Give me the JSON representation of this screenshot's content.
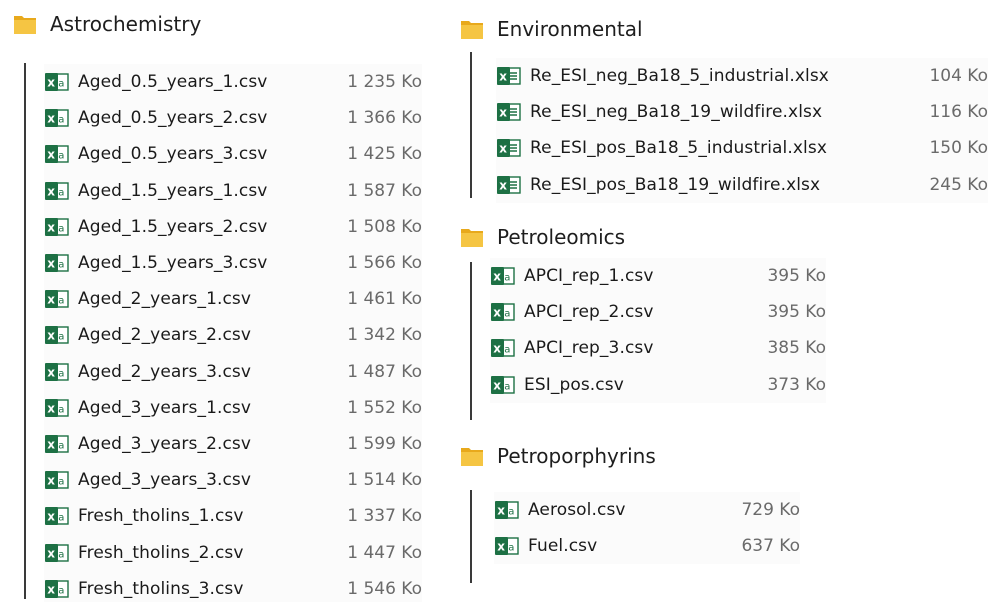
{
  "groups": [
    {
      "name": "Astrochemistry",
      "files": [
        {
          "name": "Aged_0.5_years_1.csv",
          "size": "1 235 Ko",
          "type": "csv"
        },
        {
          "name": "Aged_0.5_years_2.csv",
          "size": "1 366 Ko",
          "type": "csv"
        },
        {
          "name": "Aged_0.5_years_3.csv",
          "size": "1 425 Ko",
          "type": "csv"
        },
        {
          "name": "Aged_1.5_years_1.csv",
          "size": "1 587 Ko",
          "type": "csv"
        },
        {
          "name": "Aged_1.5_years_2.csv",
          "size": "1 508 Ko",
          "type": "csv"
        },
        {
          "name": "Aged_1.5_years_3.csv",
          "size": "1 566 Ko",
          "type": "csv"
        },
        {
          "name": "Aged_2_years_1.csv",
          "size": "1 461 Ko",
          "type": "csv"
        },
        {
          "name": "Aged_2_years_2.csv",
          "size": "1 342 Ko",
          "type": "csv"
        },
        {
          "name": "Aged_2_years_3.csv",
          "size": "1 487 Ko",
          "type": "csv"
        },
        {
          "name": "Aged_3_years_1.csv",
          "size": "1 552 Ko",
          "type": "csv"
        },
        {
          "name": "Aged_3_years_2.csv",
          "size": "1 599 Ko",
          "type": "csv"
        },
        {
          "name": "Aged_3_years_3.csv",
          "size": "1 514 Ko",
          "type": "csv"
        },
        {
          "name": "Fresh_tholins_1.csv",
          "size": "1 337 Ko",
          "type": "csv"
        },
        {
          "name": "Fresh_tholins_2.csv",
          "size": "1 447 Ko",
          "type": "csv"
        },
        {
          "name": "Fresh_tholins_3.csv",
          "size": "1 546 Ko",
          "type": "csv"
        }
      ]
    },
    {
      "name": "Environmental",
      "files": [
        {
          "name": "Re_ESI_neg_Ba18_5_industrial.xlsx",
          "size": "104 Ko",
          "type": "xlsx"
        },
        {
          "name": "Re_ESI_neg_Ba18_19_wildfire.xlsx",
          "size": "116 Ko",
          "type": "xlsx"
        },
        {
          "name": "Re_ESI_pos_Ba18_5_industrial.xlsx",
          "size": "150 Ko",
          "type": "xlsx"
        },
        {
          "name": "Re_ESI_pos_Ba18_19_wildfire.xlsx",
          "size": "245 Ko",
          "type": "xlsx"
        }
      ]
    },
    {
      "name": "Petroleomics",
      "files": [
        {
          "name": "APCI_rep_1.csv",
          "size": "395 Ko",
          "type": "csv"
        },
        {
          "name": "APCI_rep_2.csv",
          "size": "395 Ko",
          "type": "csv"
        },
        {
          "name": "APCI_rep_3.csv",
          "size": "385 Ko",
          "type": "csv"
        },
        {
          "name": "ESI_pos.csv",
          "size": "373 Ko",
          "type": "csv"
        }
      ]
    },
    {
      "name": "Petroporphyrins",
      "files": [
        {
          "name": "Aerosol.csv",
          "size": "729 Ko",
          "type": "csv"
        },
        {
          "name": "Fuel.csv",
          "size": "637 Ko",
          "type": "csv"
        }
      ]
    }
  ],
  "colors": {
    "excel_green": "#1d7044",
    "folder_yellow": "#f5c543",
    "folder_shade": "#e8a91c",
    "size_gray": "#6a6a6a"
  }
}
